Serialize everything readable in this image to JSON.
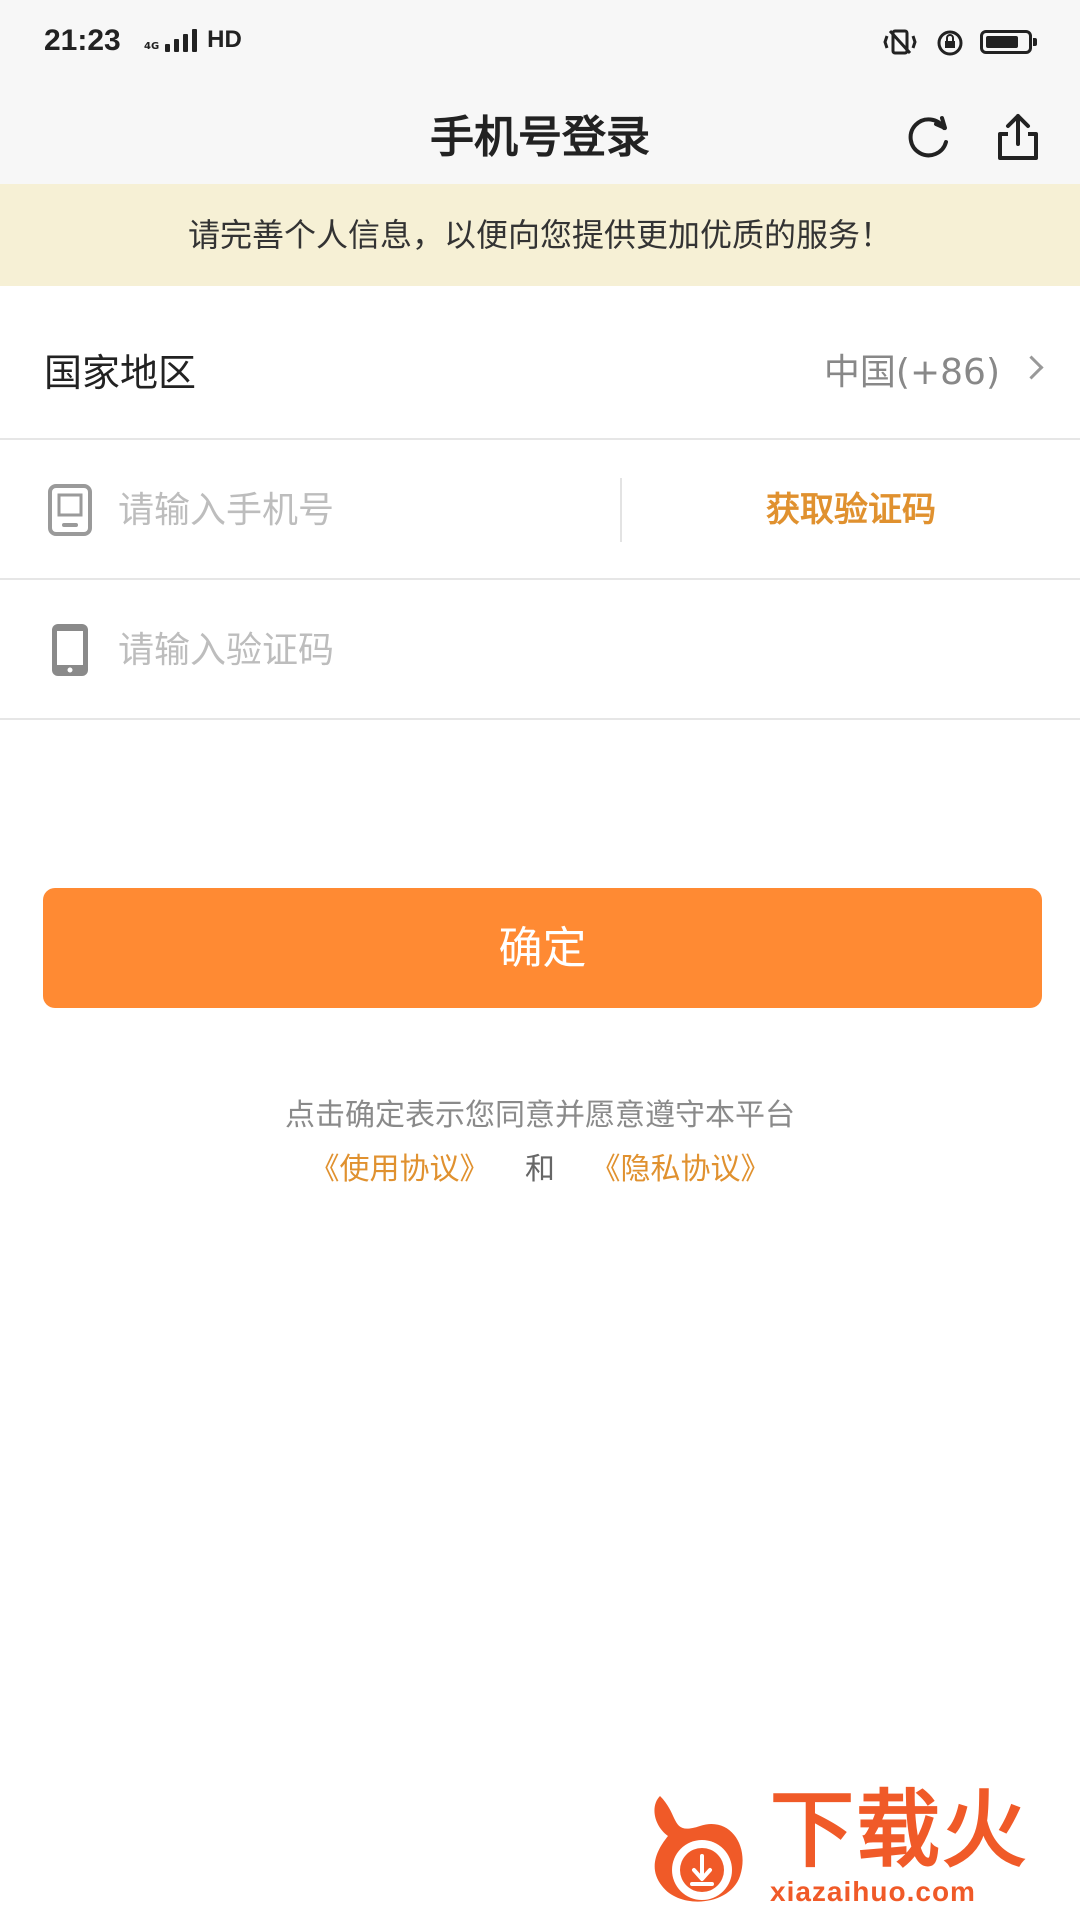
{
  "status_bar": {
    "time": "21:23",
    "network": "4G",
    "hd": "HD"
  },
  "nav": {
    "title": "手机号登录",
    "refresh_icon": "refresh-icon",
    "share_icon": "share-icon"
  },
  "notice": "请完善个人信息，以便向您提供更加优质的服务！",
  "form": {
    "region_label": "国家地区",
    "region_value": "中国(+86)",
    "phone_placeholder": "请输入手机号",
    "get_code": "获取验证码",
    "code_placeholder": "请输入验证码"
  },
  "confirm": "确定",
  "agreement": {
    "line1": "点击确定表示您同意并愿意遵守本平台",
    "terms": "《使用协议》",
    "and": "和",
    "privacy": "《隐私协议》"
  },
  "watermark": {
    "text": "下载火",
    "url": "xiazaihuo.com"
  },
  "colors": {
    "accent": "#ff8a33",
    "link": "#e0912f",
    "notice_bg": "#f6f0d5"
  }
}
